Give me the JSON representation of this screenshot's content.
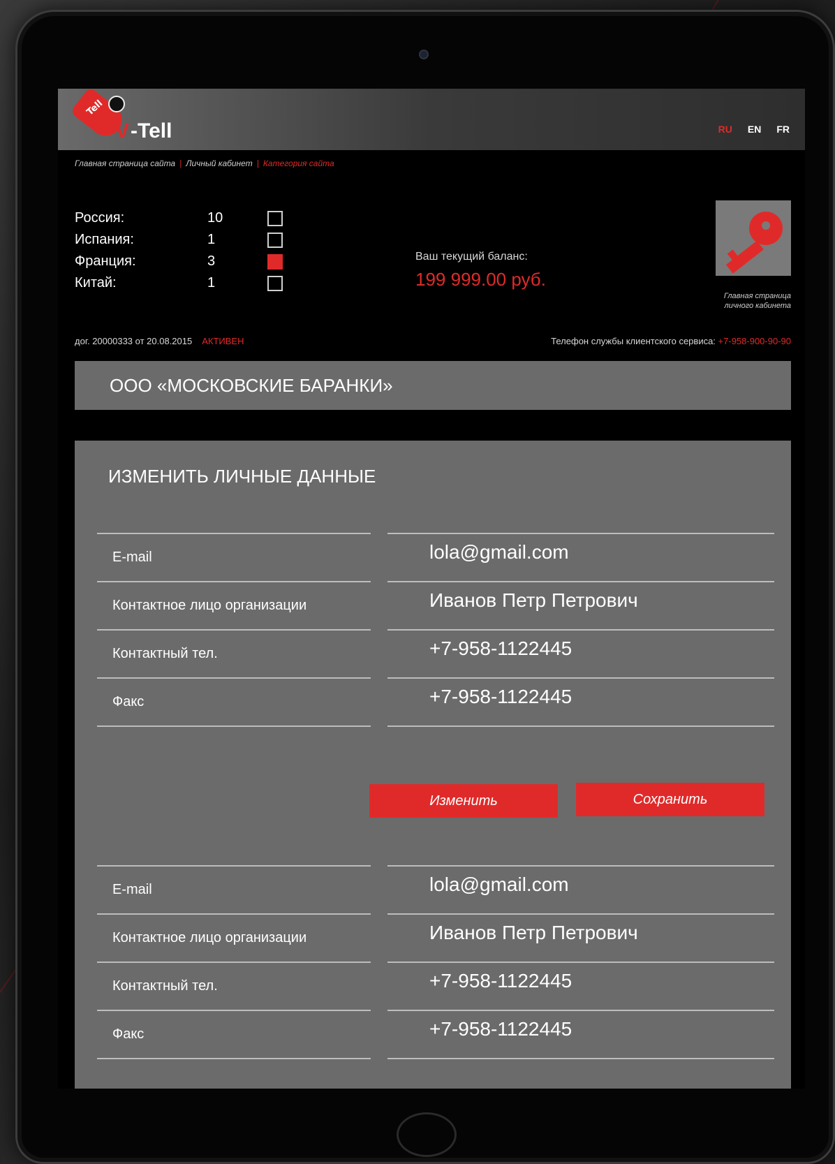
{
  "header": {
    "logo_tag": "Tell",
    "logo_v": "V",
    "logo_text": "-Tell",
    "languages": [
      {
        "label": "RU",
        "active": true
      },
      {
        "label": "EN",
        "active": false
      },
      {
        "label": "FR",
        "active": false
      }
    ]
  },
  "breadcrumb": {
    "items": [
      "Главная страница сайта",
      "Личный кабинет",
      "Категория сайта"
    ],
    "separator": "|"
  },
  "countries": [
    {
      "name": "Россия:",
      "count": "10",
      "checked": false
    },
    {
      "name": "Испания:",
      "count": "1",
      "checked": false
    },
    {
      "name": "Франция:",
      "count": "3",
      "checked": true
    },
    {
      "name": "Китай:",
      "count": "1",
      "checked": false
    }
  ],
  "balance": {
    "label": "Ваш текущий баланс:",
    "value": "199 999.00 руб."
  },
  "cabinet": {
    "icon": "key-icon",
    "label": "Главная страница личного кабинета"
  },
  "contract": {
    "text": "дог. 20000333 от 20.08.2015",
    "status": "АКТИВЕН"
  },
  "support": {
    "label": "Телефон службы клиентского сервиса:",
    "phone": "+7-958-900-90-90"
  },
  "company_name": "ООО «МОСКОВСКИЕ БАРАНКИ»",
  "panel": {
    "title": "ИЗМЕНИТЬ ЛИЧНЫЕ ДАННЫЕ",
    "form_top": [
      {
        "label": "E-mail",
        "value": "lola@gmail.com"
      },
      {
        "label": "Контактное лицо организации",
        "value": "Иванов Петр Петрович"
      },
      {
        "label": "Контактный тел.",
        "value": "+7-958-1122445"
      },
      {
        "label": "Факс",
        "value": "+7-958-1122445"
      }
    ],
    "edit_button": "Изменить",
    "save_button": "Сохранить",
    "form_bottom": [
      {
        "label": "E-mail",
        "value": "lola@gmail.com"
      },
      {
        "label": "Контактное лицо организации",
        "value": "Иванов Петр Петрович"
      },
      {
        "label": "Контактный тел.",
        "value": "+7-958-1122445"
      },
      {
        "label": "Факс",
        "value": "+7-958-1122445"
      }
    ]
  },
  "colors": {
    "accent": "#e02a2a",
    "panel": "#6b6b6b",
    "screen_bg": "#000000"
  }
}
